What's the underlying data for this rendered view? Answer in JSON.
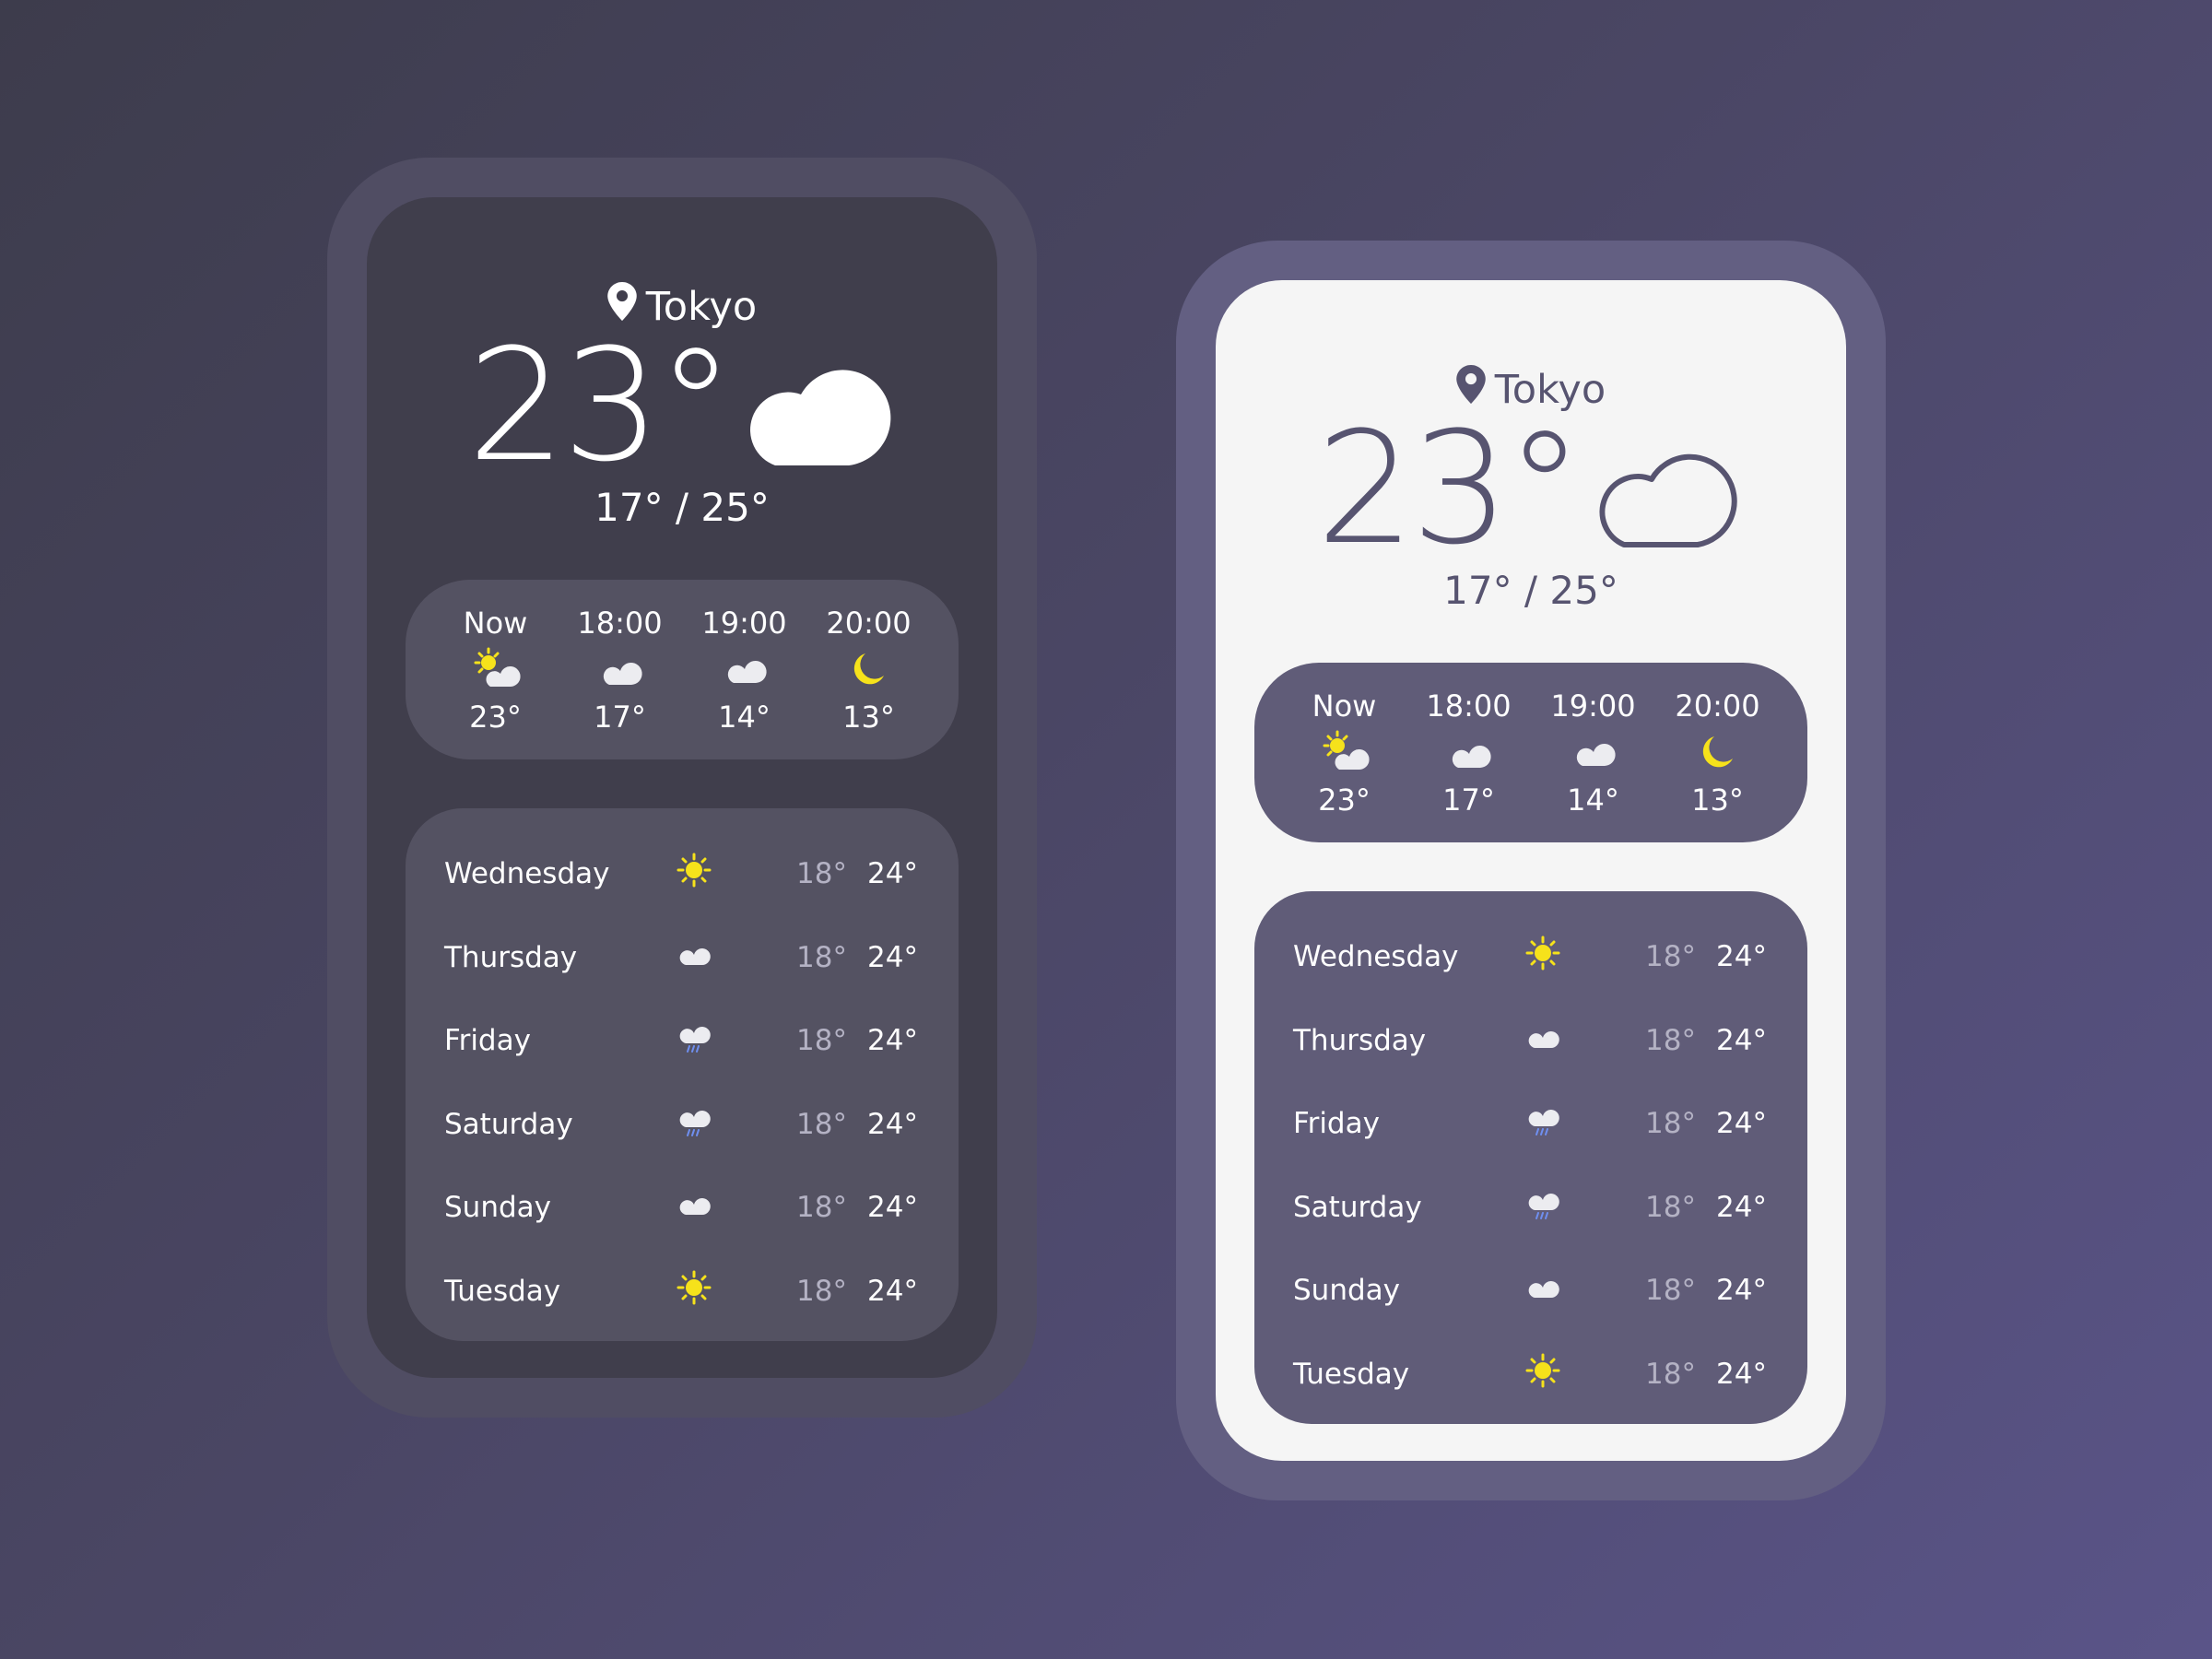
{
  "colors": {
    "sun": "#f6e21b",
    "cloud": "#ececf0",
    "rain": "#6f8ff0",
    "accent_dark": "#403e4c",
    "accent_light": "#575470"
  },
  "cards": [
    {
      "theme": "dark",
      "location": "Tokyo",
      "location_icon": "map-pin-icon",
      "current_temp": "23°",
      "current_icon": "cloud-icon",
      "range": "17° / 25°",
      "hourly": [
        {
          "time": "Now",
          "icon": "partly-sunny-icon",
          "temp": "23°"
        },
        {
          "time": "18:00",
          "icon": "cloud-icon",
          "temp": "17°"
        },
        {
          "time": "19:00",
          "icon": "cloud-icon",
          "temp": "14°"
        },
        {
          "time": "20:00",
          "icon": "moon-icon",
          "temp": "13°"
        }
      ],
      "daily": [
        {
          "day": "Wednesday",
          "icon": "sun-icon",
          "low": "18°",
          "high": "24°"
        },
        {
          "day": "Thursday",
          "icon": "cloud-icon",
          "low": "18°",
          "high": "24°"
        },
        {
          "day": "Friday",
          "icon": "rain-icon",
          "low": "18°",
          "high": "24°"
        },
        {
          "day": "Saturday",
          "icon": "rain-icon",
          "low": "18°",
          "high": "24°"
        },
        {
          "day": "Sunday",
          "icon": "cloud-icon",
          "low": "18°",
          "high": "24°"
        },
        {
          "day": "Tuesday",
          "icon": "sun-icon",
          "low": "18°",
          "high": "24°"
        }
      ]
    },
    {
      "theme": "light",
      "location": "Tokyo",
      "location_icon": "map-pin-icon",
      "current_temp": "23°",
      "current_icon": "cloud-outline-icon",
      "range": "17° / 25°",
      "hourly": [
        {
          "time": "Now",
          "icon": "partly-sunny-icon",
          "temp": "23°"
        },
        {
          "time": "18:00",
          "icon": "cloud-icon",
          "temp": "17°"
        },
        {
          "time": "19:00",
          "icon": "cloud-icon",
          "temp": "14°"
        },
        {
          "time": "20:00",
          "icon": "moon-icon",
          "temp": "13°"
        }
      ],
      "daily": [
        {
          "day": "Wednesday",
          "icon": "sun-icon",
          "low": "18°",
          "high": "24°"
        },
        {
          "day": "Thursday",
          "icon": "cloud-icon",
          "low": "18°",
          "high": "24°"
        },
        {
          "day": "Friday",
          "icon": "rain-icon",
          "low": "18°",
          "high": "24°"
        },
        {
          "day": "Saturday",
          "icon": "rain-icon",
          "low": "18°",
          "high": "24°"
        },
        {
          "day": "Sunday",
          "icon": "cloud-icon",
          "low": "18°",
          "high": "24°"
        },
        {
          "day": "Tuesday",
          "icon": "sun-icon",
          "low": "18°",
          "high": "24°"
        }
      ]
    }
  ]
}
